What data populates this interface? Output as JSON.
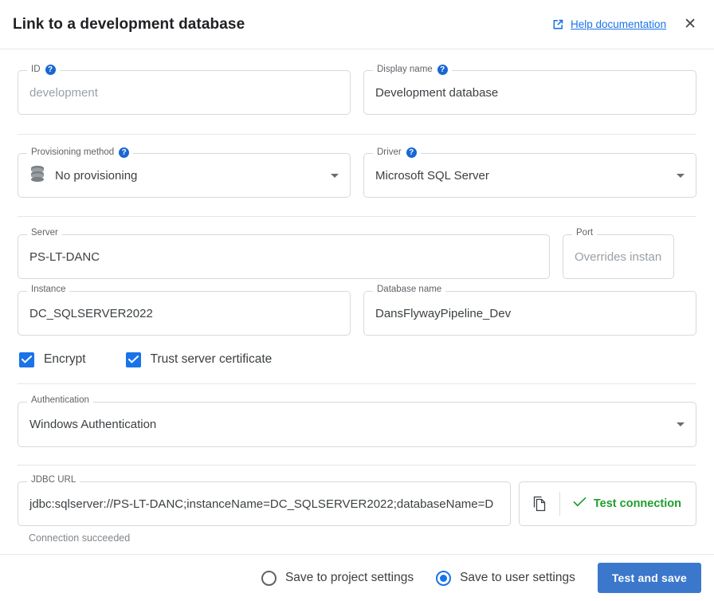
{
  "header": {
    "title": "Link to a development database",
    "help_icon": "external-link-icon",
    "help_label": "Help documentation",
    "close_label": "✕"
  },
  "colors": {
    "accent_blue": "#1a73e8",
    "button_blue": "#3b78cc",
    "success_green": "#1e9e2e",
    "border_grey": "#d6d8da",
    "label_grey": "#5f6368",
    "placeholder_grey": "#9aa0a6"
  },
  "form": {
    "id": {
      "label": "ID",
      "help_icon": "help-circle-icon",
      "value": "",
      "placeholder": "development"
    },
    "display_name": {
      "label": "Display name",
      "help_icon": "help-circle-icon",
      "value": "Development database",
      "placeholder": ""
    },
    "provisioning_method": {
      "label": "Provisioning method",
      "help_icon": "help-circle-icon",
      "value": "No provisioning",
      "leading_icon": "database-stack-icon",
      "caret": "chevron-down-icon"
    },
    "driver": {
      "label": "Driver",
      "help_icon": "help-circle-icon",
      "value": "Microsoft SQL Server",
      "caret": "chevron-down-icon"
    },
    "server": {
      "label": "Server",
      "value": "PS-LT-DANC"
    },
    "port": {
      "label": "Port",
      "value": "",
      "placeholder": "Overrides instanc"
    },
    "instance": {
      "label": "Instance",
      "value": "DC_SQLSERVER2022"
    },
    "database_name": {
      "label": "Database name",
      "value": "DansFlywayPipeline_Dev"
    },
    "encrypt": {
      "label": "Encrypt",
      "checked": true
    },
    "trust_server_certificate": {
      "label": "Trust server certificate",
      "checked": true
    },
    "authentication": {
      "label": "Authentication",
      "value": "Windows Authentication",
      "caret": "chevron-down-icon"
    },
    "jdbc_url": {
      "label": "JDBC URL",
      "value": "jdbc:sqlserver://PS-LT-DANC;instanceName=DC_SQLSERVER2022;databaseName=D"
    },
    "copy_icon": "copy-icon",
    "test_connection": {
      "label": "Test connection",
      "icon": "check-icon"
    },
    "status": "Connection succeeded"
  },
  "footer": {
    "save_project": {
      "label": "Save to project settings",
      "selected": false
    },
    "save_user": {
      "label": "Save to user settings",
      "selected": true
    },
    "primary_button": "Test and save"
  }
}
